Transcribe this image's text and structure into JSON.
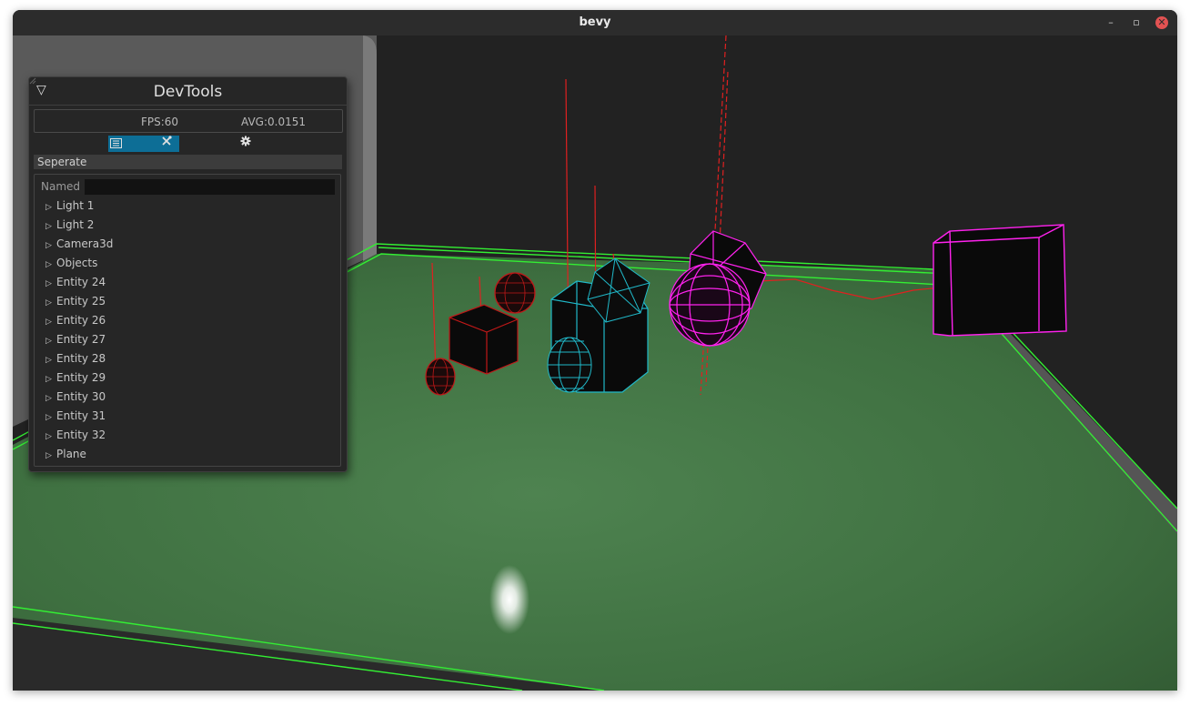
{
  "window": {
    "title": "bevy",
    "minimize_glyph": "–",
    "maximize_glyph": "▫",
    "close_glyph": "✕"
  },
  "devtools": {
    "collapse_glyph": "▽",
    "title": "DevTools",
    "fps": "FPS:60",
    "avg": "AVG:0.0151",
    "tabs": [
      {
        "icon": "search-icon",
        "active": false
      },
      {
        "icon": "hierarchy-icon",
        "active": true
      },
      {
        "icon": "tools-icon",
        "active": false
      },
      {
        "icon": "gear-icon",
        "active": false
      }
    ],
    "mode_label": "Seperate",
    "filter": {
      "label": "Named",
      "value": ""
    },
    "entities": [
      {
        "label": "Light 1"
      },
      {
        "label": "Light 2"
      },
      {
        "label": "Camera3d"
      },
      {
        "label": "Objects"
      },
      {
        "label": "Entity 24"
      },
      {
        "label": "Entity 25"
      },
      {
        "label": "Entity 26"
      },
      {
        "label": "Entity 27"
      },
      {
        "label": "Entity 28"
      },
      {
        "label": "Entity 29"
      },
      {
        "label": "Entity 30"
      },
      {
        "label": "Entity 31"
      },
      {
        "label": "Entity 32"
      },
      {
        "label": "Plane"
      }
    ],
    "expand_glyph": "▷"
  },
  "colors": {
    "ground": "#3f7040",
    "wire_green": "#33ee33",
    "wire_red": "#e02020",
    "wire_cyan": "#20b8c8",
    "wire_magenta": "#ff22ee",
    "accent": "#0d6e96"
  }
}
